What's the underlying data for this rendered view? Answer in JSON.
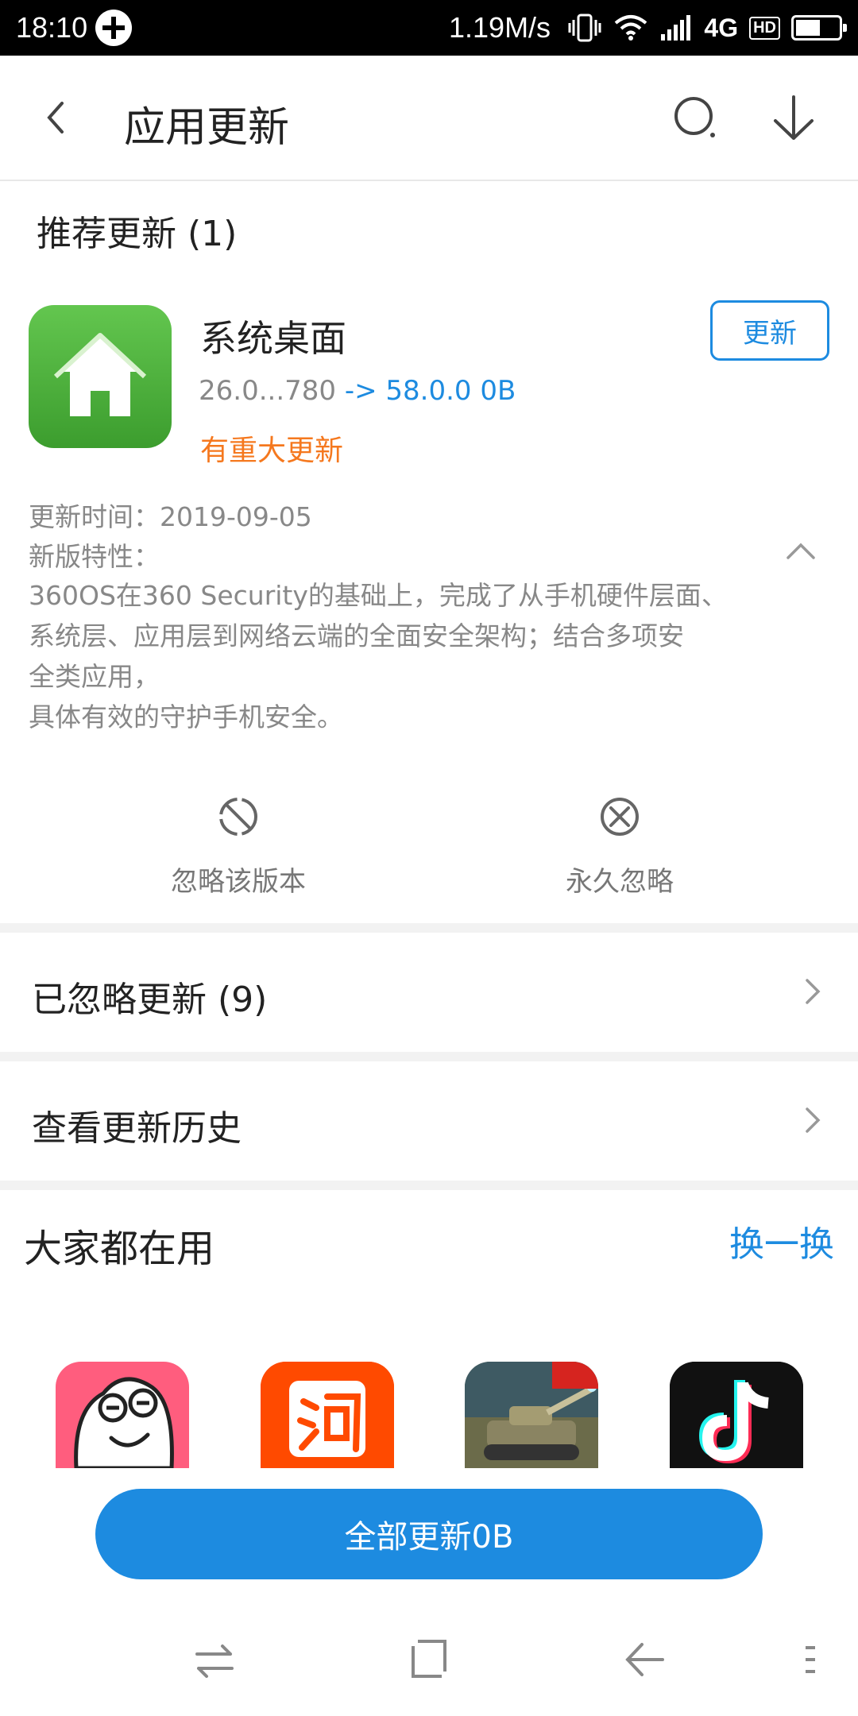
{
  "status_bar": {
    "time": "18:10",
    "speed": "1.19M/s",
    "network": "4G",
    "hd": "HD"
  },
  "header": {
    "title": "应用更新",
    "icons": [
      "back-icon",
      "search-icon",
      "download-icon"
    ]
  },
  "recommended": {
    "title": "推荐更新 (1)",
    "app": {
      "name": "系统桌面",
      "old_version": "26.0...780",
      "arrow": "->",
      "new_version": "58.0.0",
      "size": "0B",
      "major_label": "有重大更新",
      "update_button": "更新",
      "update_time": "更新时间：2019-09-05",
      "features_label": "新版特性：",
      "features_body": "360OS在360 Security的基础上，完成了从手机硬件层面、\n系统层、应用层到网络云端的全面安全架构；结合多项安\n全类应用，\n具体有效的守护手机安全。"
    },
    "actions": {
      "ignore_version": "忽略该版本",
      "ignore_forever": "永久忽略"
    }
  },
  "rows": {
    "ignored": "已忽略更新 (9)",
    "history": "查看更新历史"
  },
  "everyone": {
    "title": "大家都在用",
    "refresh": "换一换",
    "apps": [
      "app-icon-1",
      "app-icon-2",
      "app-icon-3",
      "app-icon-4"
    ]
  },
  "bottom": {
    "update_all": "全部更新0B"
  },
  "colors": {
    "accent": "#1d8be0",
    "warning": "#f5781e",
    "muted": "#888888"
  }
}
